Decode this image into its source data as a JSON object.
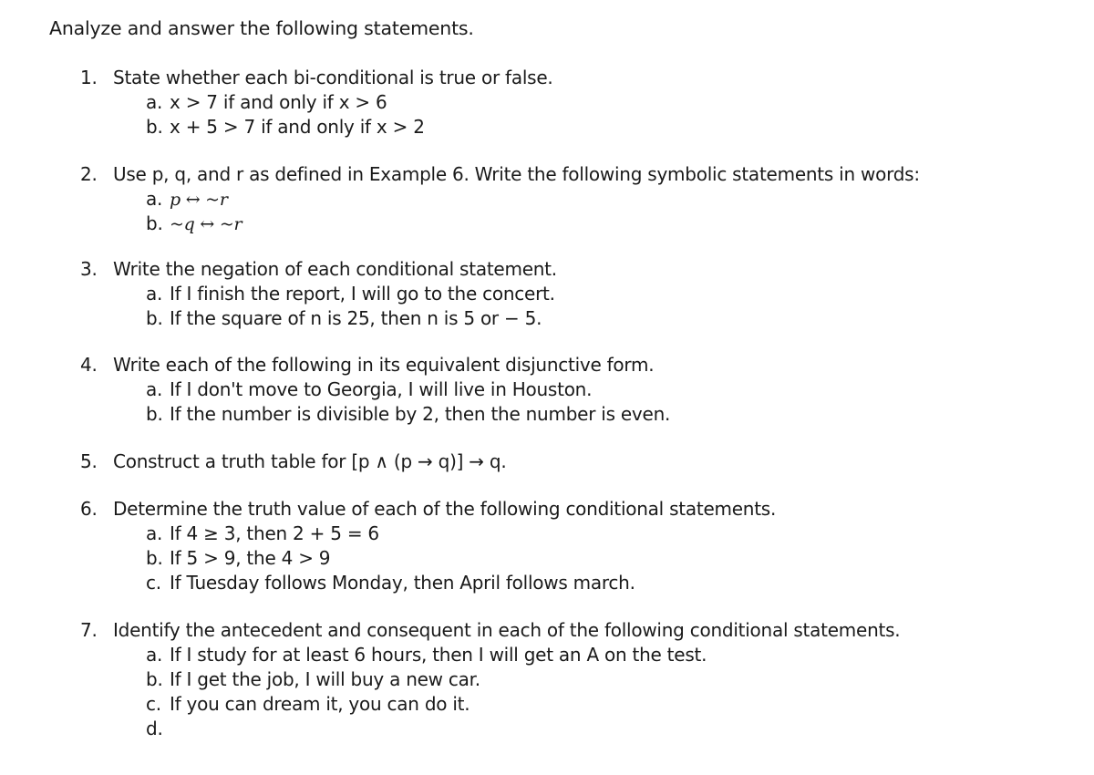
{
  "intro": "Analyze and answer the following statements.",
  "questions": [
    {
      "number": "1.",
      "prompt": "State whether each bi-conditional is true or false.",
      "items": [
        {
          "label": "a.",
          "text": "x > 7 if and only if x > 6"
        },
        {
          "label": "b.",
          "text": "x + 5 > 7 if and only if x > 2"
        }
      ]
    },
    {
      "number": "2.",
      "prompt": "Use p, q, and r as defined in Example 6. Write the following symbolic statements in words:",
      "items": [
        {
          "label": "a.",
          "text": "p ↔ ~r"
        },
        {
          "label": "b.",
          "text": "~q ↔ ~r"
        }
      ]
    },
    {
      "number": "3.",
      "prompt": "Write the negation of each conditional statement.",
      "items": [
        {
          "label": "a.",
          "text": "If I finish the report, I will go to the concert."
        },
        {
          "label": "b.",
          "text": "If the square of n is 25, then n is 5 or − 5."
        }
      ]
    },
    {
      "number": "4.",
      "prompt": "Write each of the following in its equivalent disjunctive form.",
      "items": [
        {
          "label": "a.",
          "text": "If I don't move to Georgia, I will live in Houston."
        },
        {
          "label": "b.",
          "text": "If the number is divisible by 2, then the number is even."
        }
      ]
    },
    {
      "number": "5.",
      "prompt": "Construct a truth table for [p ∧ (p → q)] → q.",
      "items": []
    },
    {
      "number": "6.",
      "prompt": "Determine the truth value of each of the following conditional statements.",
      "items": [
        {
          "label": "a.",
          "text": "If 4 ≥ 3, then 2 + 5 = 6"
        },
        {
          "label": "b.",
          "text": "If 5 > 9, the 4 > 9"
        },
        {
          "label": "c.",
          "text": "If Tuesday follows Monday, then April follows march."
        }
      ]
    },
    {
      "number": "7.",
      "prompt": "Identify the antecedent and consequent in each of the following conditional statements.",
      "items": [
        {
          "label": "a.",
          "text": "If I study for at least 6 hours, then I will get an A on the test."
        },
        {
          "label": "b.",
          "text": "If I get the job, I will buy a new car."
        },
        {
          "label": "c.",
          "text": "If you can dream it, you can do it."
        },
        {
          "label": "d.",
          "text": ""
        }
      ]
    }
  ]
}
